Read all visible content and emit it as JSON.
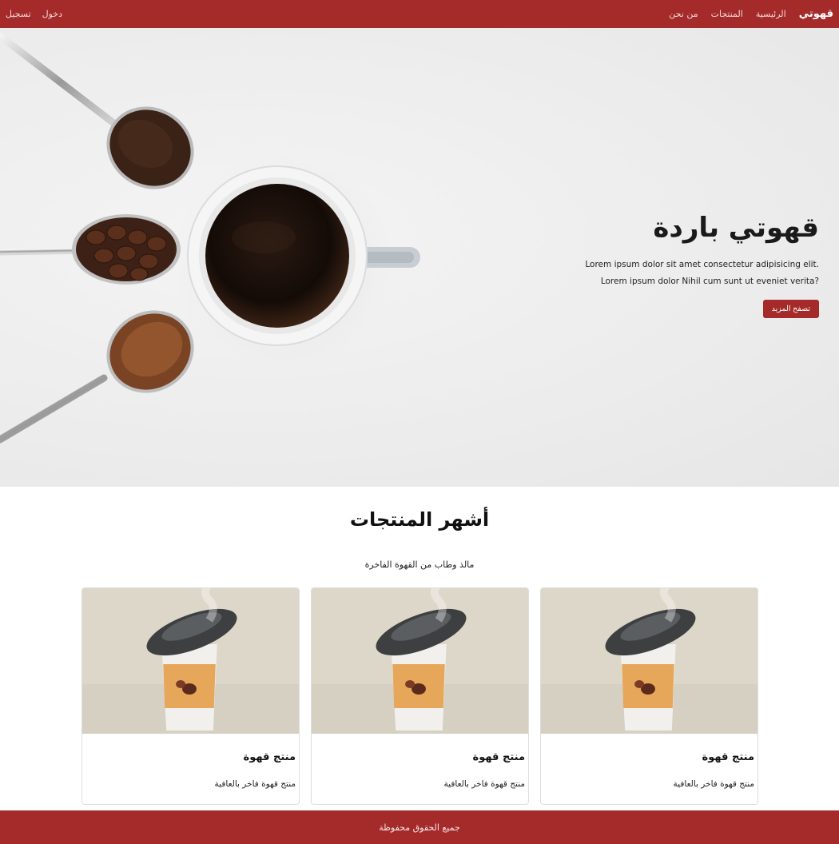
{
  "nav": {
    "brand": "قهوتي",
    "links": [
      "الرئيسية",
      "المنتجات",
      "من نحن"
    ],
    "login": "دخول",
    "register": "تسجيل"
  },
  "hero": {
    "title": "قهوتي باردة",
    "line1": "Lorem ipsum dolor sit amet consectetur adipisicing elit.",
    "line2": "Lorem ipsum dolor Nihil cum sunt ut eveniet verita?",
    "button": "تصفح المزيد"
  },
  "products": {
    "title": "أشهر المنتجات",
    "subtitle": "مالذ وطاب من القهوة الفاخرة",
    "cards": [
      {
        "title": "منتج قهوة",
        "text": "منتج قهوة فاخر بالعافية"
      },
      {
        "title": "منتج قهوة",
        "text": "منتج قهوة فاخر بالعافية"
      },
      {
        "title": "منتج قهوة",
        "text": "منتج قهوة فاخر بالعافية"
      }
    ]
  },
  "footer": {
    "text": "جميع الحقوق محفوظة"
  },
  "colors": {
    "brand": "#a52a2a"
  }
}
